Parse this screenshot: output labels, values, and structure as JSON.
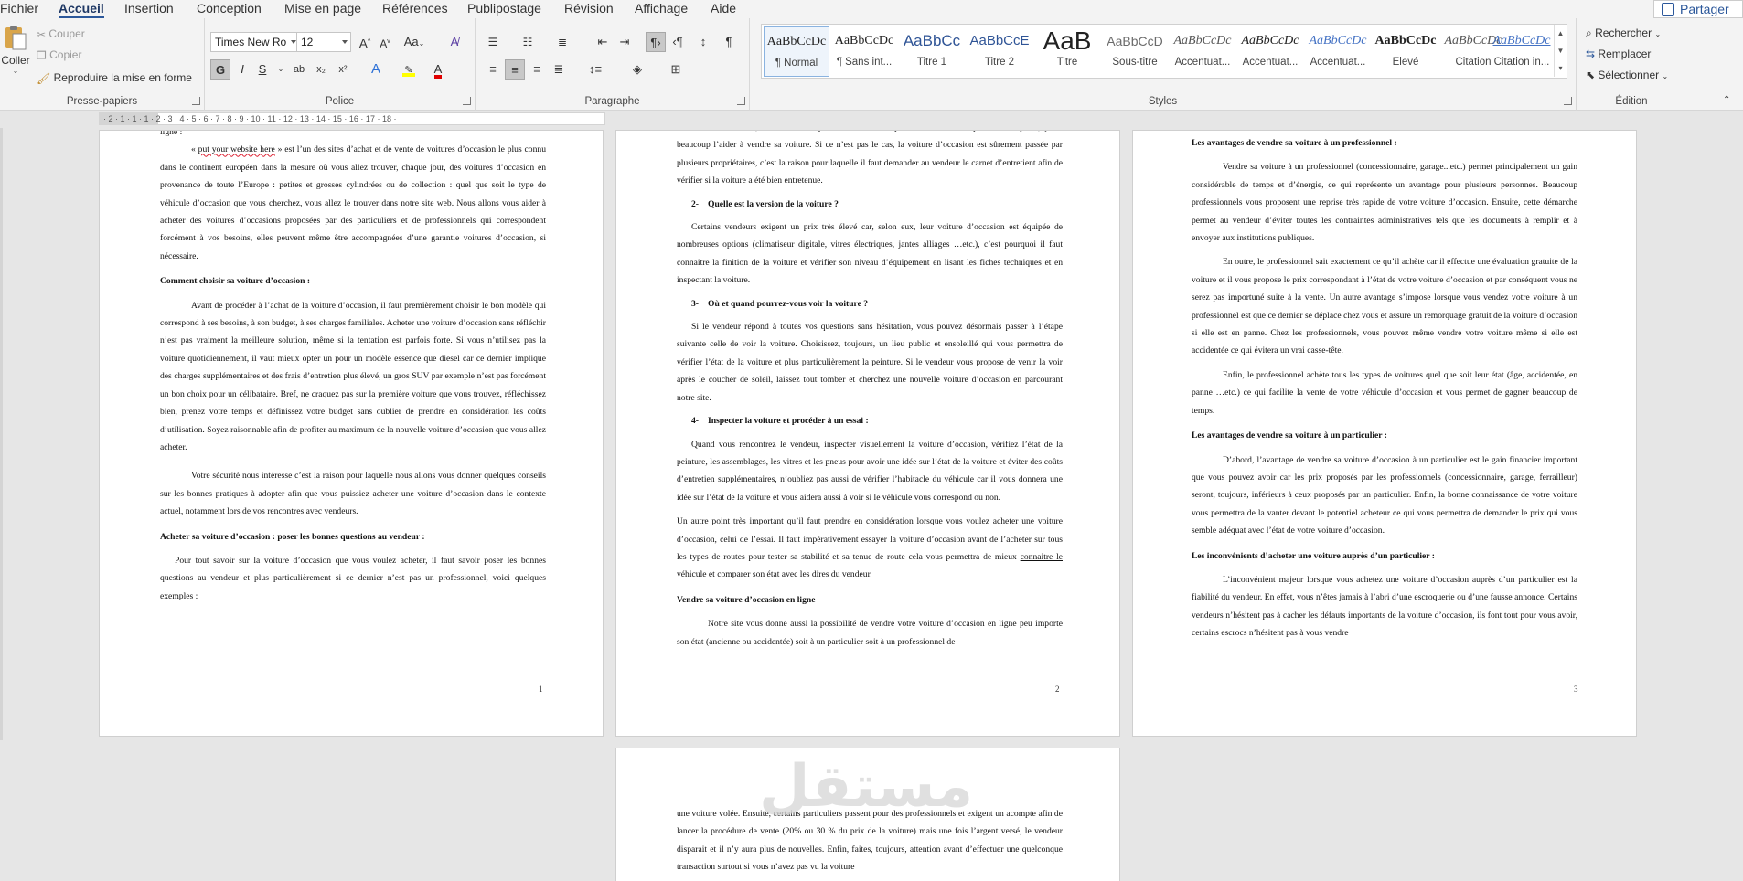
{
  "menu": {
    "tabs": [
      {
        "label": "Fichier"
      },
      {
        "label": "Accueil"
      },
      {
        "label": "Insertion"
      },
      {
        "label": "Conception"
      },
      {
        "label": "Mise en page"
      },
      {
        "label": "Références"
      },
      {
        "label": "Publipostage"
      },
      {
        "label": "Révision"
      },
      {
        "label": "Affichage"
      },
      {
        "label": "Aide"
      }
    ],
    "active_tab": "Accueil",
    "share_label": "Partager"
  },
  "ribbon": {
    "clipboard": {
      "group_label": "Presse-papiers",
      "paste_label": "Coller",
      "cut_label": "Couper",
      "copy_label": "Copier",
      "format_painter_label": "Reproduire la mise en forme"
    },
    "font": {
      "group_label": "Police",
      "font_name": "Times New Ro",
      "font_size": "12",
      "grow_label": "A",
      "shrink_label": "A",
      "case_label": "Aa",
      "bold": "G",
      "italic": "I",
      "underline": "S",
      "strike": "ab",
      "subscript": "x₂",
      "superscript": "x²",
      "text_effects": "A",
      "font_color_letter": "A",
      "highlight_color": "#ffff00",
      "font_color": "#e00000"
    },
    "paragraph": {
      "group_label": "Paragraphe",
      "pilcrow": "¶"
    },
    "styles": {
      "group_label": "Styles",
      "items": [
        {
          "preview": "AaBbCcDc",
          "name": "¶ Normal"
        },
        {
          "preview": "AaBbCcDc",
          "name": "¶ Sans int..."
        },
        {
          "preview": "AaBbCc",
          "name": "Titre 1"
        },
        {
          "preview": "AaBbCcE",
          "name": "Titre 2"
        },
        {
          "preview": "AaB",
          "name": "Titre"
        },
        {
          "preview": "AaBbCcD",
          "name": "Sous-titre"
        },
        {
          "preview": "AaBbCcDc",
          "name": "Accentuat..."
        },
        {
          "preview": "AaBbCcDc",
          "name": "Accentuat..."
        },
        {
          "preview": "AaBbCcDc",
          "name": "Accentuat..."
        },
        {
          "preview": "AaBbCcDc",
          "name": "Élevé"
        },
        {
          "preview": "AaBbCcDc",
          "name": "Citation"
        },
        {
          "preview": "AaBbCcDc",
          "name": "Citation in..."
        }
      ]
    },
    "editing": {
      "group_label": "Édition",
      "find_label": "Rechercher",
      "replace_label": "Remplacer",
      "select_label": "Sélectionner"
    }
  },
  "ruler": {
    "text": "· 2 · 1 · 1 · 1 · 2 · 3 · 4 · 5 · 6 · 7 · 8 · 9 · 10 · 11 · 12 · 13 · 14 · 15 · 16 · 17 · 18 ·"
  },
  "pages": {
    "p1": {
      "top_fragment": "ligne :",
      "link_text": "put your website here",
      "intro_rest": " » est l’un des sites d’achat et de vente de voitures d’occasion le plus connu dans le continent européen dans la mesure où vous allez trouver, chaque jour, des voitures d’occasion en provenance de toute l’Europe : petites et grosses cylindrées ou de collection : quel que soit le type de véhicule d’occasion que vous cherchez, vous allez le trouver dans notre site web. Nous allons vous aider à acheter des voitures d’occasions proposées par des particuliers et de professionnels qui correspondent forcément à vos besoins, elles peuvent même être accompagnées d’une garantie voitures d’occasion, si nécessaire.",
      "h1": "Comment choisir sa voiture d’occasion :",
      "para2": "Avant de procéder à l’achat de la voiture d’occasion, il faut premièrement choisir le bon modèle qui correspond à ses besoins, à son budget, à ses charges familiales. Acheter une voiture d’occasion sans réfléchir n’est pas vraiment la meilleure solution, même si la tentation est parfois forte. Si vous n’utilisez pas la voiture quotidiennement, il vaut mieux opter un pour un modèle essence que diesel car ce dernier implique des charges supplémentaires et des frais d’entretien plus élevé, un gros SUV par exemple n’est pas forcément un bon choix pour un célibataire. Bref, ne craquez pas sur la première voiture que vous trouvez, réfléchissez bien, prenez votre temps et définissez votre budget sans oublier de prendre en considération les coûts d’utilisation. Soyez raisonnable afin de profiter au maximum de la nouvelle voiture d’occasion que vous allez acheter.",
      "para3": "Votre sécurité nous intéresse c’est la raison pour laquelle nous allons vous donner quelques conseils sur les bonnes pratiques à adopter afin que vous puissiez acheter une voiture d’occasion dans le contexte actuel, notamment lors de vos rencontres avec vendeurs.",
      "h2": "Acheter sa voiture d’occasion : poser les bonnes questions au vendeur :",
      "para4": "Pour tout savoir sur la voiture d’occasion que vous voulez acheter, il faut savoir poser les bonnes questions au vendeur et plus particulièrement si ce dernier n’est pas un professionnel, voici quelques exemples :",
      "page_number": "1"
    },
    "p2": {
      "top_fragment": "sa mise en circulation, le vendeur n’a qu’à vous montrer le premier titulaire. S’il possède une pièce, ça va beaucoup l’aider à vendre sa voiture. Si ce n’est pas le cas, la voiture d’occasion est sûrement passée par plusieurs propriétaires, c’est la raison pour laquelle il faut demander au vendeur le carnet d’entretient afin de vérifier si la voiture a été bien entretenue.",
      "h2_num": "2-",
      "h2": "Quelle est la version de la voiture ?",
      "para_v": "Certains vendeurs exigent un prix très élevé car, selon eux, leur voiture d’occasion est équipée de nombreuses options (climatiseur digitale, vitres électriques, jantes alliages …etc.), c’est pourquoi il faut connaitre la finition de la voiture et vérifier son niveau d’équipement en lisant les fiches techniques et en inspectant la voiture.",
      "h3_num": "3-",
      "h3": "Où et quand pourrez-vous voir la voiture ?",
      "para_o": "Si le vendeur répond à toutes vos questions sans hésitation, vous pouvez désormais passer à l’étape suivante celle de voir la voiture. Choisissez, toujours, un lieu public et ensoleillé qui vous permettra de vérifier l’état de la voiture et plus particulièrement la peinture. Si le vendeur vous propose de venir la voir après le coucher de soleil, laissez tout tomber et cherchez une nouvelle voiture d’occasion en parcourant notre site.",
      "h4_num": "4-",
      "h4": "Inspecter la voiture et procéder à un essai :",
      "para_i": "Quand vous rencontrez le vendeur, inspecter visuellement la voiture d’occasion, vérifiez l’état de la peinture, les assemblages, les vitres et les pneus pour avoir une idée sur l’état de la voiture et éviter des coûts d’entretien supplémentaires, n’oubliez pas aussi de vérifier l’habitacle du véhicule car il vous donnera une idée sur l’état de la voiture et vous aidera aussi à voir si le véhicule vous correspond ou non.",
      "para_e1": "Un autre point très important qu’il faut prendre en considération lorsque vous voulez acheter une voiture d’occasion, celui de l’essai. Il faut impérativement essayer la voiture d’occasion avant de l’acheter sur tous les types de routes pour tester sa stabilité et sa tenue de route cela vous permettra de mieux ",
      "para_e_link": "connaitre  le",
      "para_e2": " véhicule et comparer son état avec les dires du vendeur.",
      "h5": "Vendre sa voiture d’occasion en ligne",
      "para_s": "Notre site vous donne aussi la possibilité de vendre votre voiture d’occasion en ligne peu importe son état (ancienne ou accidentée) soit à un particulier soit à un professionnel de",
      "page_number": "2"
    },
    "p3": {
      "h1": "Les avantages de vendre sa voiture à un professionnel :",
      "para1": "Vendre sa voiture à un professionnel (concessionnaire, garage...etc.) permet principalement un gain considérable de temps et d’énergie, ce qui représente un avantage pour plusieurs personnes. Beaucoup professionnels vous proposent une reprise très rapide de votre voiture d’occasion. Ensuite, cette démarche permet au vendeur d’éviter toutes les contraintes administratives tels que les documents à remplir et à envoyer aux institutions publiques.",
      "para2": "En outre, le professionnel sait exactement ce qu’il achète car il effectue une évaluation gratuite de la voiture et il vous propose le prix correspondant à l’état de votre voiture d’occasion et par conséquent vous ne serez pas importuné suite à la vente. Un autre avantage s’impose lorsque vous vendez votre voiture à un professionnel est que ce dernier se déplace chez vous et assure un remorquage gratuit de la voiture d’occasion si elle est en panne. Chez les professionnels, vous pouvez même vendre votre voiture même si elle est accidentée ce qui évitera un vrai casse-tête.",
      "para3": "Enfin, le professionnel achète tous les types de voitures quel que soit leur état (âge, accidentée, en panne …etc.) ce qui facilite la vente de votre véhicule d’occasion et vous permet de gagner beaucoup de temps.",
      "h2": "Les avantages de vendre sa voiture à un particulier :",
      "para4": "D’abord, l’avantage de vendre sa voiture d’occasion à un particulier est le gain financier important que vous pouvez avoir car les prix proposés par les professionnels (concessionnaire, garage, ferrailleur) seront, toujours, inférieurs à ceux proposés par un particulier.  Enfin, la bonne connaissance de votre voiture vous permettra de la vanter devant le potentiel acheteur ce qui vous permettra de demander le prix qui vous semble adéquat avec l’état de votre voiture d’occasion.",
      "h3": "Les inconvénients d’acheter une voiture auprès d’un particulier :",
      "para5": "L’inconvénient majeur lorsque vous achetez une voiture d’occasion auprès d’un particulier est la fiabilité du vendeur. En effet, vous n’êtes jamais à l’abri d’une escroquerie ou d’une fausse annonce. Certains vendeurs n’hésitent pas à cacher les défauts importants de la voiture d’occasion, ils font tout pour vous avoir, certains escrocs n’hésitent pas à vous vendre",
      "page_number": "3"
    },
    "p4": {
      "para1": "une voiture volée. Ensuite, certains particuliers passent pour des professionnels et exigent un acompte afin de lancer la procédure de vente (20% ou 30 % du prix de la voiture) mais une fois l’argent versé, le vendeur disparait et il n’y aura plus de nouvelles.  Enfin, faites, toujours, attention avant d’effectuer une quelconque transaction surtout si vous n’avez pas vu la voiture"
    }
  },
  "watermark": "مستقل"
}
